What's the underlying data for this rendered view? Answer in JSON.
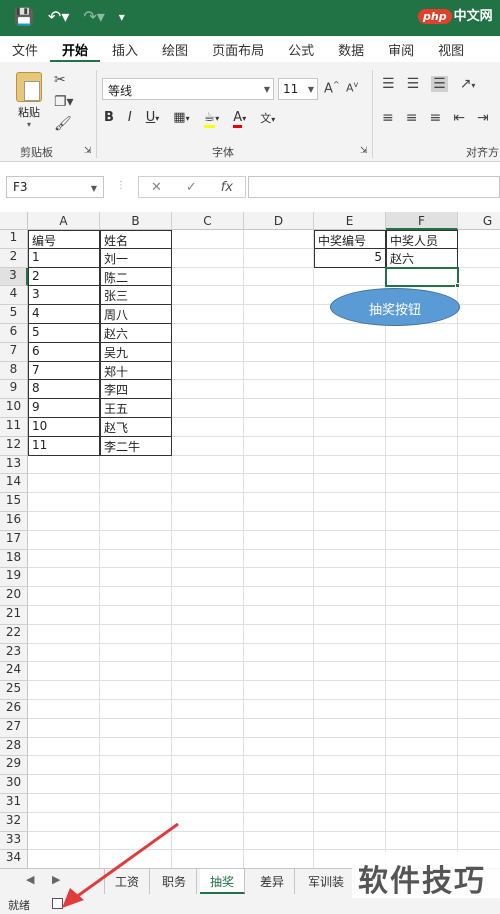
{
  "logo": {
    "badge": "php",
    "text": "中文网"
  },
  "ribbon_tabs": [
    "文件",
    "开始",
    "插入",
    "绘图",
    "页面布局",
    "公式",
    "数据",
    "审阅",
    "视图"
  ],
  "ribbon": {
    "paste_label": "粘贴",
    "clipboard_group": "剪贴板",
    "font_group": "字体",
    "align_group": "对齐方",
    "font_name": "等线",
    "font_size": "11",
    "bold": "B",
    "italic": "I",
    "underline": "U",
    "grow_font": "A",
    "shrink_font": "A",
    "phonetic": "文"
  },
  "formula_bar": {
    "name_box": "F3",
    "cancel": "✕",
    "confirm": "✓",
    "fx": "fx",
    "value": ""
  },
  "columns": [
    "A",
    "B",
    "C",
    "D",
    "E",
    "F",
    "G"
  ],
  "rows": [
    "1",
    "2",
    "3",
    "4",
    "5",
    "6",
    "7",
    "8",
    "9",
    "10",
    "11",
    "12",
    "13",
    "14",
    "15",
    "16",
    "17",
    "18",
    "19",
    "20",
    "21",
    "22",
    "23",
    "24",
    "25",
    "26",
    "27",
    "28",
    "29",
    "30",
    "31",
    "32",
    "33",
    "34"
  ],
  "table": {
    "header": [
      "编号",
      "姓名"
    ],
    "rows": [
      [
        "1",
        "刘一"
      ],
      [
        "2",
        "陈二"
      ],
      [
        "3",
        "张三"
      ],
      [
        "4",
        "周八"
      ],
      [
        "5",
        "赵六"
      ],
      [
        "6",
        "吴九"
      ],
      [
        "7",
        "郑十"
      ],
      [
        "8",
        "李四"
      ],
      [
        "9",
        "王五"
      ],
      [
        "10",
        "赵飞"
      ],
      [
        "11",
        "李二牛"
      ]
    ]
  },
  "result": {
    "header": [
      "中奖编号",
      "中奖人员"
    ],
    "number": "5",
    "name": "赵六"
  },
  "shape_button": {
    "label": "抽奖按钮"
  },
  "sheet_tabs": [
    "工资",
    "职务",
    "抽奖",
    "差异",
    "军训装"
  ],
  "active_sheet": "抽奖",
  "status": {
    "text": "就绪"
  },
  "watermark": {
    "text": "软件技巧"
  },
  "accent_color": "#217346"
}
